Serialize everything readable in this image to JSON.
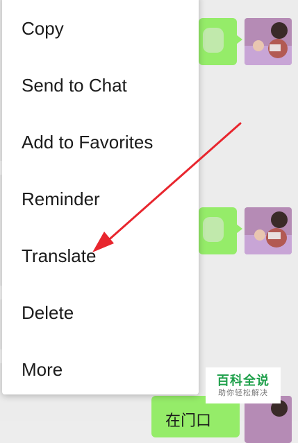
{
  "context_menu": {
    "items": [
      {
        "label": "Copy"
      },
      {
        "label": "Send to Chat"
      },
      {
        "label": "Add to Favorites"
      },
      {
        "label": "Reminder"
      },
      {
        "label": "Translate"
      },
      {
        "label": "Delete"
      },
      {
        "label": "More"
      }
    ]
  },
  "watermark": {
    "title": "百科全说",
    "subtitle": "助你轻松解决"
  },
  "bottom_message": {
    "text": "在门口"
  },
  "colors": {
    "bubble": "#95ec69",
    "arrow": "#e8262e",
    "watermark_green": "#1fa04b"
  }
}
